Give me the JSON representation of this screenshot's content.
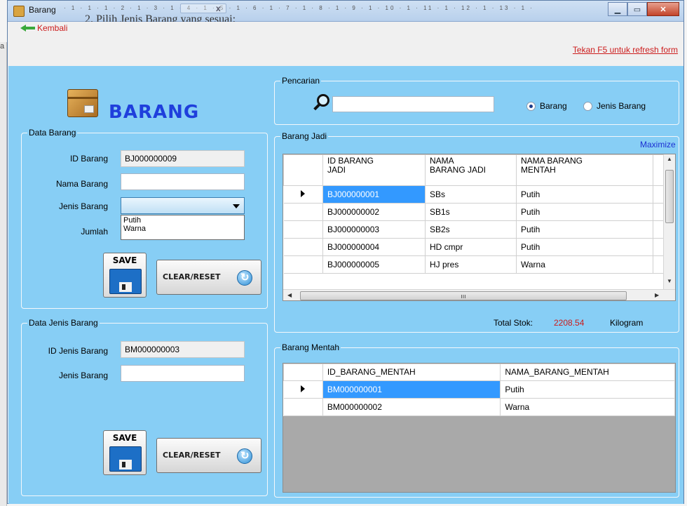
{
  "window": {
    "title": "Barang",
    "ghost_doc_text": "2.   Pilih Jenis Barang yang sesuai:",
    "ruler_text": "· 1 · 1 · 1 · 2 · 1 · 3 · 1 · 4 · 1 · 5 · 1 · 6 · 1 · 7 · 1 · 8 · 1 · 9 · 1 · 10 · 1 · 11 · 1 · 12 · 1 · 13 · 1 ·",
    "ruler_close": "x",
    "left_margin_mark": "a"
  },
  "links": {
    "back": "Kembali",
    "refresh": "Tekan F5 untuk refresh form"
  },
  "header": {
    "title": "BARANG"
  },
  "data_barang": {
    "group_title": "Data Barang",
    "id_label": "ID Barang",
    "id_value": "BJ000000009",
    "nama_label": "Nama Barang",
    "nama_value": "",
    "jenis_label": "Jenis Barang",
    "jenis_value": "",
    "jenis_options": [
      "Putih",
      "Warna"
    ],
    "jumlah_label": "Jumlah",
    "save_label": "SAVE",
    "clear_label": "CLEAR/RESET"
  },
  "data_jenis": {
    "group_title": "Data Jenis Barang",
    "id_label": "ID Jenis Barang",
    "id_value": "BM000000003",
    "jenis_label": "Jenis Barang",
    "jenis_value": "",
    "save_label": "SAVE",
    "clear_label": "CLEAR/RESET"
  },
  "pencarian": {
    "group_title": "Pencarian",
    "search_value": "",
    "radio_barang": "Barang",
    "radio_jenis": "Jenis Barang",
    "selected": "Barang"
  },
  "barang_jadi": {
    "group_title": "Barang Jadi",
    "maximize": "Maximize",
    "columns": [
      "ID BARANG\nJADI",
      "NAMA\nBARANG JADI",
      "NAMA BARANG\nMENTAH"
    ],
    "rows": [
      {
        "id": "BJ000000001",
        "nama": "SBs",
        "mentah": "Putih",
        "extra": ""
      },
      {
        "id": "BJ000000002",
        "nama": "SB1s",
        "mentah": "Putih",
        "extra": ""
      },
      {
        "id": "BJ000000003",
        "nama": "SB2s",
        "mentah": "Putih",
        "extra": ""
      },
      {
        "id": "BJ000000004",
        "nama": "HD cmpr",
        "mentah": "Putih",
        "extra": ""
      },
      {
        "id": "BJ000000005",
        "nama": "HJ pres",
        "mentah": "Warna",
        "extra": ""
      }
    ],
    "total_label": "Total Stok:",
    "total_value": "2208.54",
    "total_unit": "Kilogram"
  },
  "barang_mentah": {
    "group_title": "Barang Mentah",
    "columns": [
      "ID_BARANG_MENTAH",
      "NAMA_BARANG_MENTAH"
    ],
    "rows": [
      {
        "id": "BM000000001",
        "nama": "Putih"
      },
      {
        "id": "BM000000002",
        "nama": "Warna"
      }
    ]
  },
  "colors": {
    "panel_bg": "#87cef5",
    "title_blue": "#1f3fdc",
    "link_red": "#cc1b1b",
    "selection": "#3399ff"
  },
  "icons": [
    "back-arrow-icon",
    "box-icon",
    "search-icon",
    "floppy-disk-icon",
    "refresh-icon"
  ]
}
